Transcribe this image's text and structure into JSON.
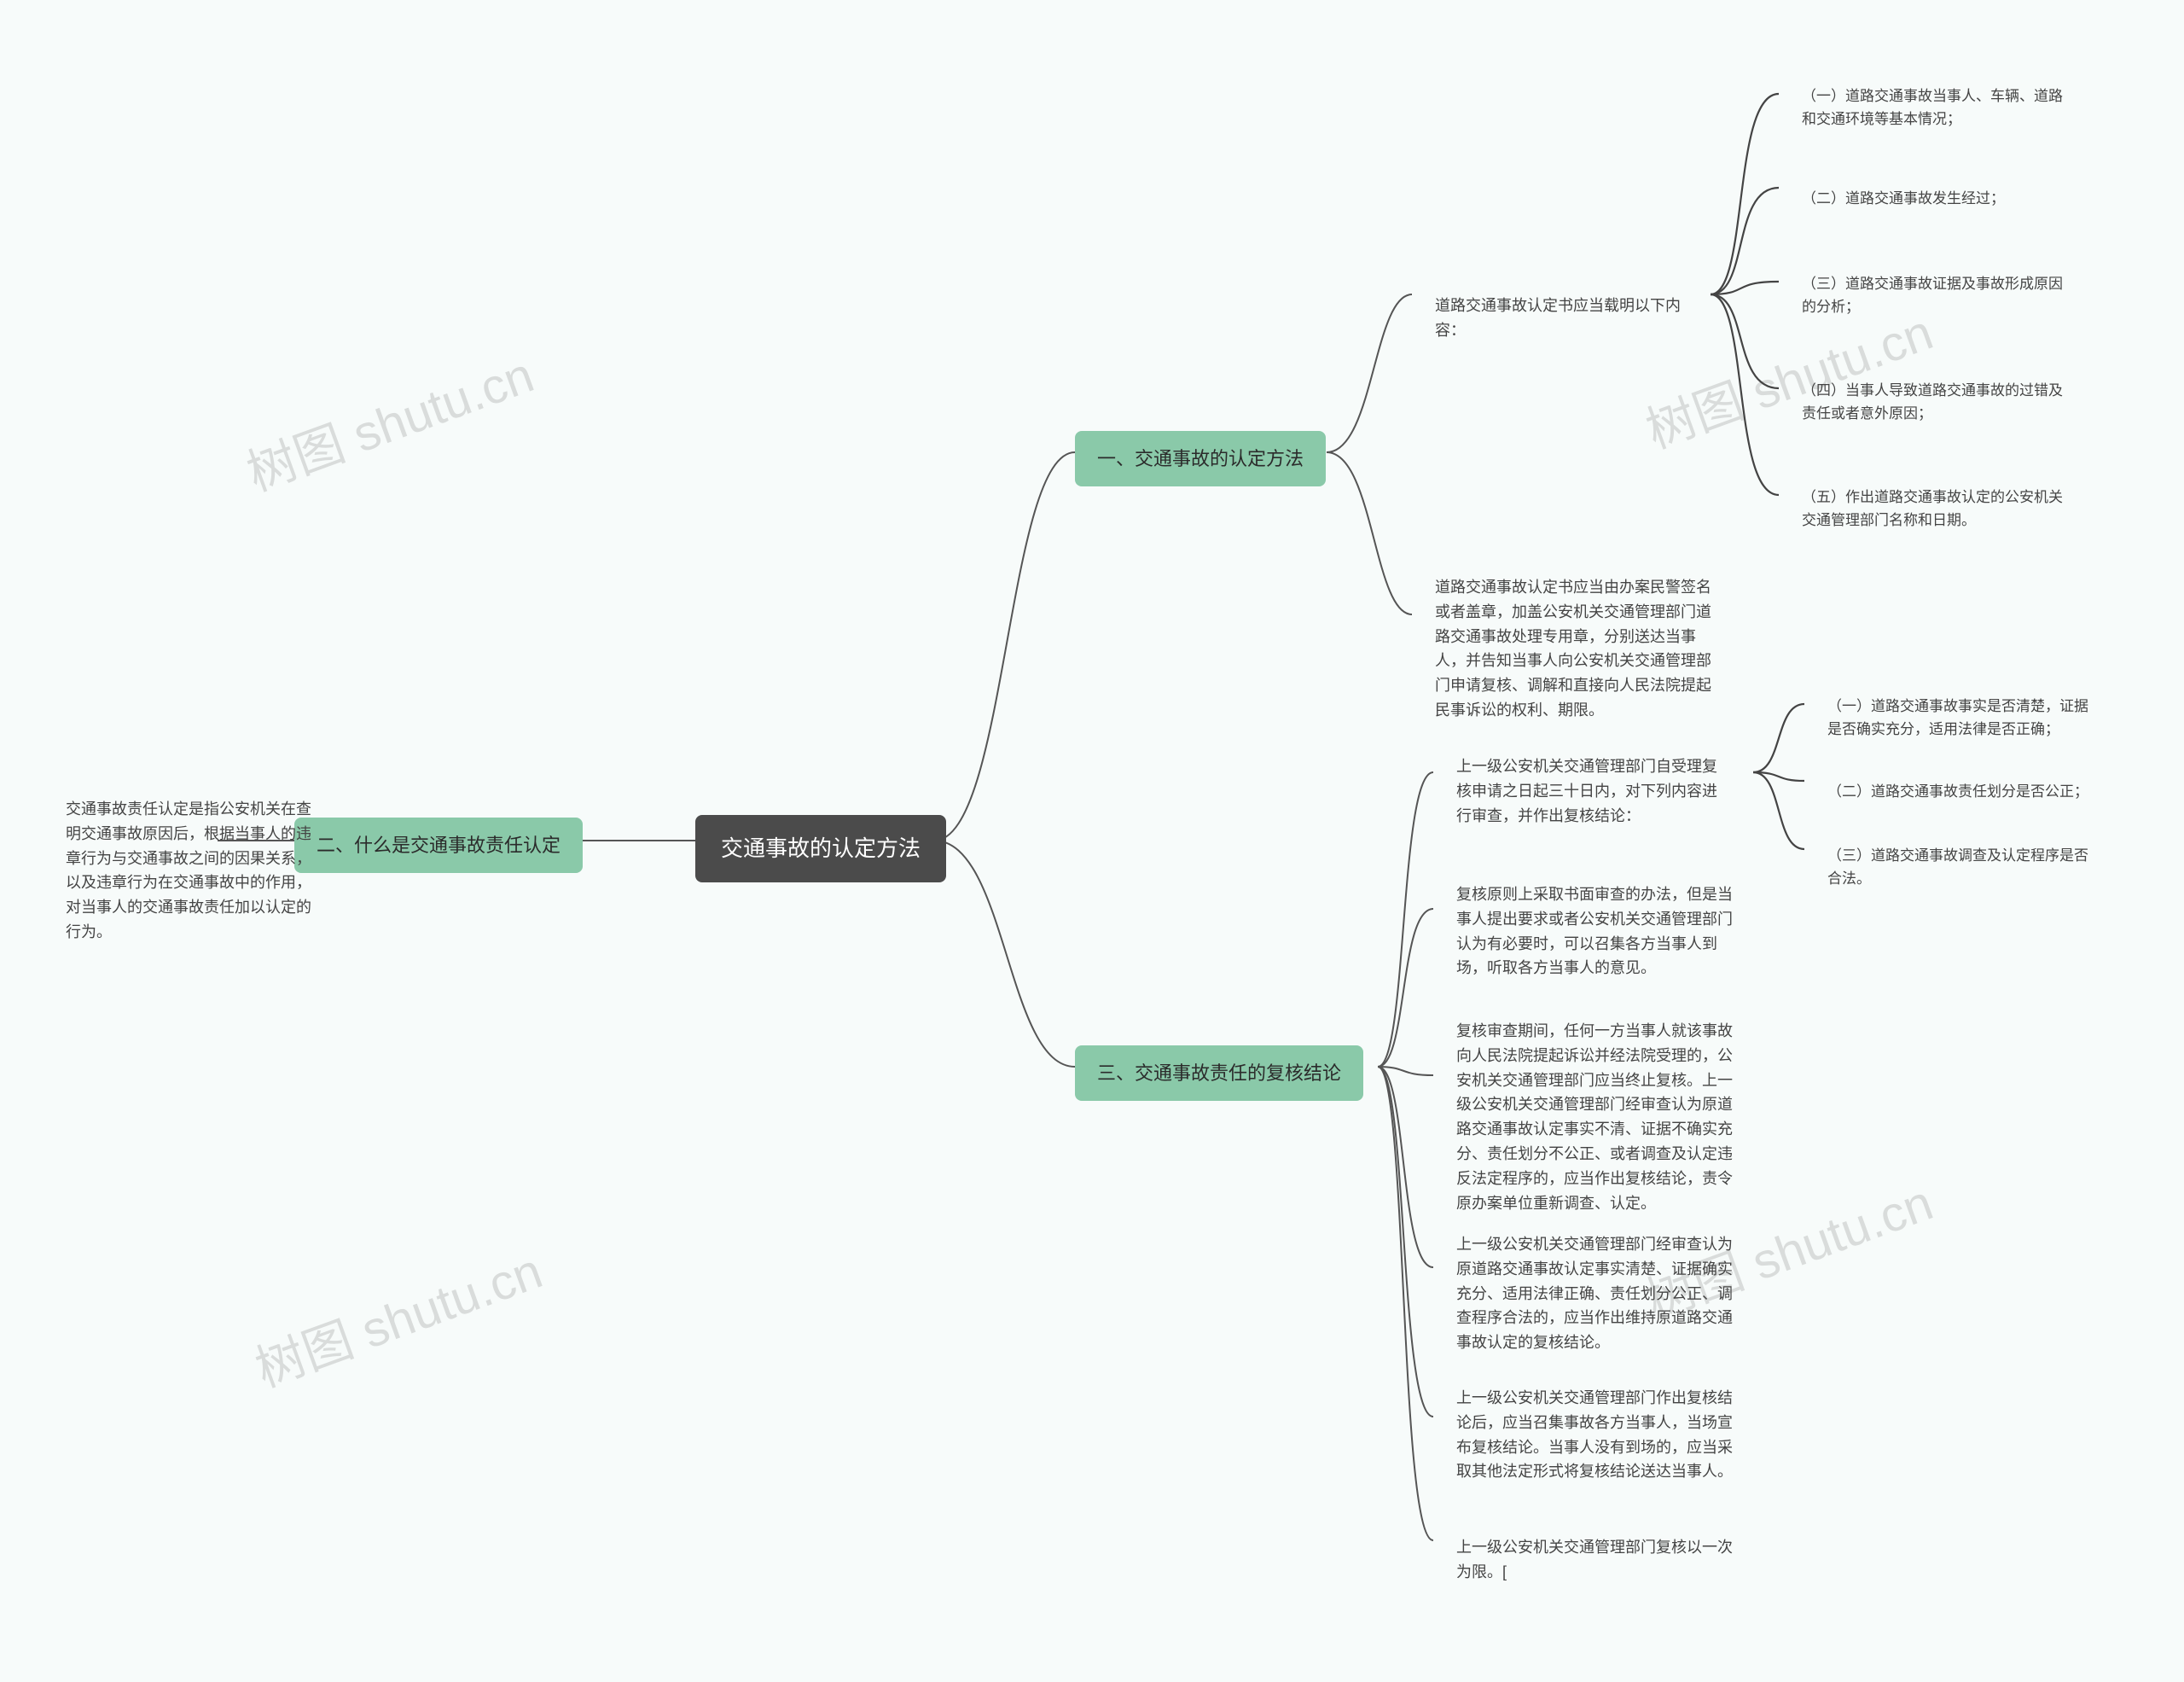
{
  "watermark": "树图 shutu.cn",
  "root": {
    "title": "交通事故的认定方法"
  },
  "branch1": {
    "title": "一、交通事故的认定方法",
    "sub1": {
      "lead": "道路交通事故认定书应当载明以下内容：",
      "items": [
        "（一）道路交通事故当事人、车辆、道路和交通环境等基本情况；",
        "（二）道路交通事故发生经过；",
        "（三）道路交通事故证据及事故形成原因的分析；",
        "（四）当事人导致道路交通事故的过错及责任或者意外原因；",
        "（五）作出道路交通事故认定的公安机关交通管理部门名称和日期。"
      ]
    },
    "sub2": "道路交通事故认定书应当由办案民警签名或者盖章，加盖公安机关交通管理部门道路交通事故处理专用章，分别送达当事人，并告知当事人向公安机关交通管理部门申请复核、调解和直接向人民法院提起民事诉讼的权利、期限。"
  },
  "branch2": {
    "title": "二、什么是交通事故责任认定",
    "desc": "交通事故责任认定是指公安机关在查明交通事故原因后，根据当事人的违章行为与交通事故之间的因果关系，以及违章行为在交通事故中的作用，对当事人的交通事故责任加以认定的行为。"
  },
  "branch3": {
    "title": "三、交通事故责任的复核结论",
    "sub1": {
      "lead": "上一级公安机关交通管理部门自受理复核申请之日起三十日内，对下列内容进行审查，并作出复核结论：",
      "items": [
        "（一）道路交通事故事实是否清楚，证据是否确实充分，适用法律是否正确；",
        "（二）道路交通事故责任划分是否公正；",
        "（三）道路交通事故调查及认定程序是否合法。"
      ]
    },
    "sub2": "复核原则上采取书面审查的办法，但是当事人提出要求或者公安机关交通管理部门认为有必要时，可以召集各方当事人到场，听取各方当事人的意见。",
    "sub3": "复核审查期间，任何一方当事人就该事故向人民法院提起诉讼并经法院受理的，公安机关交通管理部门应当终止复核。上一级公安机关交通管理部门经审查认为原道路交通事故认定事实不清、证据不确实充分、责任划分不公正、或者调查及认定违反法定程序的，应当作出复核结论，责令原办案单位重新调查、认定。",
    "sub4": "上一级公安机关交通管理部门经审查认为原道路交通事故认定事实清楚、证据确实充分、适用法律正确、责任划分公正、调查程序合法的，应当作出维持原道路交通事故认定的复核结论。",
    "sub5": "上一级公安机关交通管理部门作出复核结论后，应当召集事故各方当事人，当场宣布复核结论。当事人没有到场的，应当采取其他法定形式将复核结论送达当事人。",
    "sub6": "上一级公安机关交通管理部门复核以一次为限。["
  }
}
